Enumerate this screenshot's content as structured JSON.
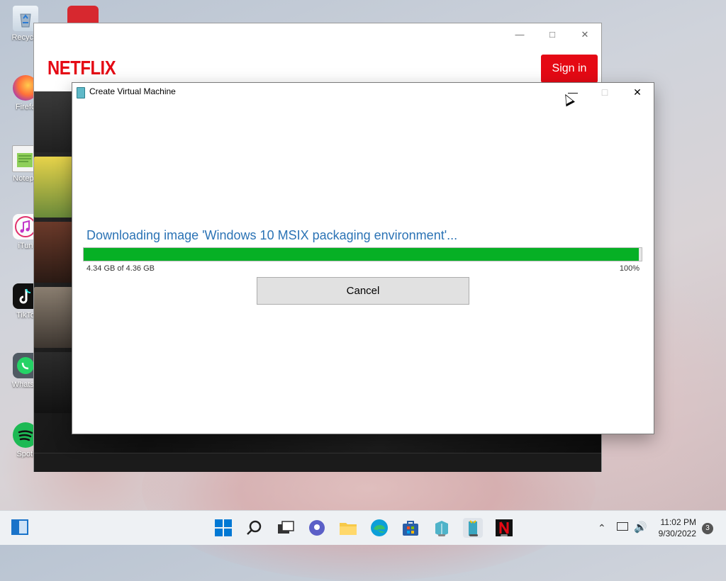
{
  "desktop": {
    "icons": [
      {
        "label": "Recycle",
        "icon": "recycle-bin-icon",
        "color": "#d9e4ee"
      },
      {
        "label": "Firefo",
        "icon": "firefox-icon",
        "color": "#ff7139"
      },
      {
        "label": "Notepa",
        "icon": "notepad-icon",
        "color": "#7ec04e"
      },
      {
        "label": "iTun",
        "icon": "itunes-icon",
        "color": "#f2f2f2"
      },
      {
        "label": "TikTo",
        "icon": "tiktok-icon",
        "color": "#111111"
      },
      {
        "label": "WhatsA",
        "icon": "whatsapp-icon",
        "color": "#25d366"
      },
      {
        "label": "Spoti",
        "icon": "spotify-icon",
        "color": "#1db954"
      }
    ]
  },
  "netflix": {
    "logo": "NETFLIX",
    "signin_label": "Sign in",
    "brand_color": "#e50914"
  },
  "dialog": {
    "title": "Create Virtual Machine",
    "status": "Downloading image 'Windows 10 MSIX packaging environment'...",
    "progress_size": "4.34 GB of 4.36 GB",
    "progress_percent": "100%",
    "progress_fraction": 0.995,
    "cancel_label": "Cancel",
    "accent_color": "#2b73b5",
    "progress_color": "#06b025"
  },
  "taskbar": {
    "apps": [
      {
        "name": "start-button",
        "icon": "windows-start-icon",
        "color": "#0078d4"
      },
      {
        "name": "search-button",
        "icon": "search-icon",
        "color": "#222222"
      },
      {
        "name": "task-view-button",
        "icon": "task-view-icon",
        "color": "#333333"
      },
      {
        "name": "chat-button",
        "icon": "teams-chat-icon",
        "color": "#5b5fc7"
      },
      {
        "name": "file-explorer-button",
        "icon": "folder-icon",
        "color": "#f7c948"
      },
      {
        "name": "edge-button",
        "icon": "edge-icon",
        "color": "#0c9fd8"
      },
      {
        "name": "store-button",
        "icon": "store-icon",
        "color": "#2a5fa8"
      },
      {
        "name": "app-button-1",
        "icon": "packaging-icon",
        "color": "#4fb3c9"
      },
      {
        "name": "hyperv-quick-create-button",
        "icon": "hyperv-icon",
        "color": "#3aa6c0"
      },
      {
        "name": "netflix-taskbar-button",
        "icon": "netflix-icon",
        "color": "#e50914"
      }
    ],
    "clock_time": "11:02 PM",
    "clock_date": "9/30/2022",
    "notification_count": "3"
  }
}
